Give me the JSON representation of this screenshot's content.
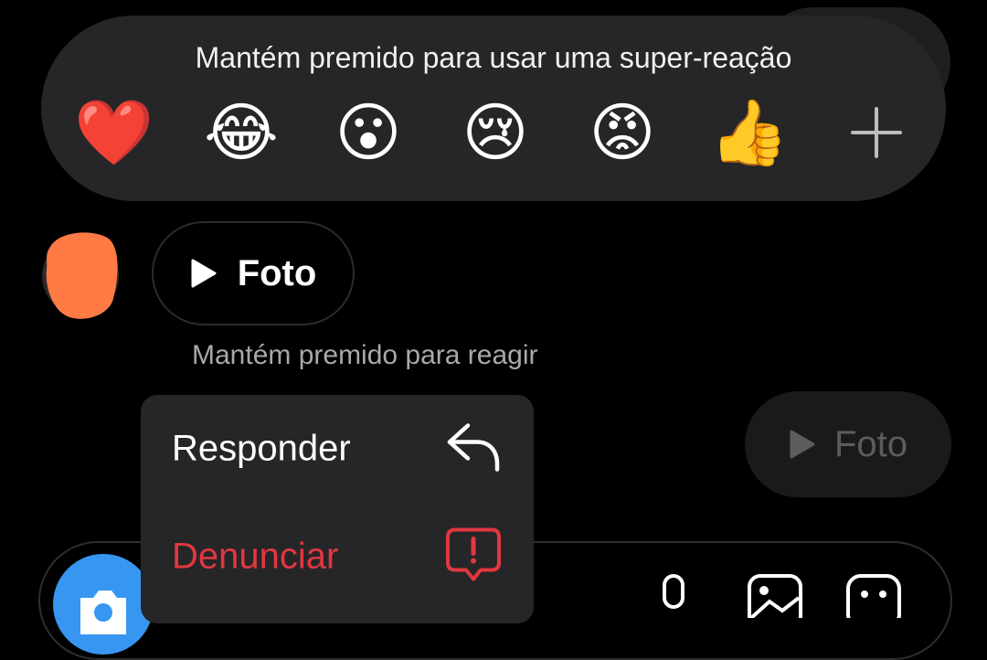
{
  "reaction_panel": {
    "hint": "Mantém premido para usar uma super-reação",
    "emojis": [
      {
        "glyph": "❤️",
        "name": "heart"
      },
      {
        "glyph": "😂",
        "name": "tears-of-joy"
      },
      {
        "glyph": "😮",
        "name": "surprised"
      },
      {
        "glyph": "😢",
        "name": "crying"
      },
      {
        "glyph": "😡",
        "name": "angry"
      },
      {
        "glyph": "👍",
        "name": "thumbs-up"
      }
    ],
    "more_icon": "plus-icon"
  },
  "messages": {
    "received_photo_label": "Foto",
    "hold_hint": "Mantém premido para reagir",
    "sent_photo_label": "Foto"
  },
  "context_menu": {
    "reply_label": "Responder",
    "reply_icon": "reply-arrow-icon",
    "report_label": "Denunciar",
    "report_icon": "report-alert-icon"
  },
  "colors": {
    "panel_bg": "#262628",
    "report_red": "#e2373f",
    "camera_blue": "#3797f0",
    "avatar_orange": "#ff7a45"
  }
}
